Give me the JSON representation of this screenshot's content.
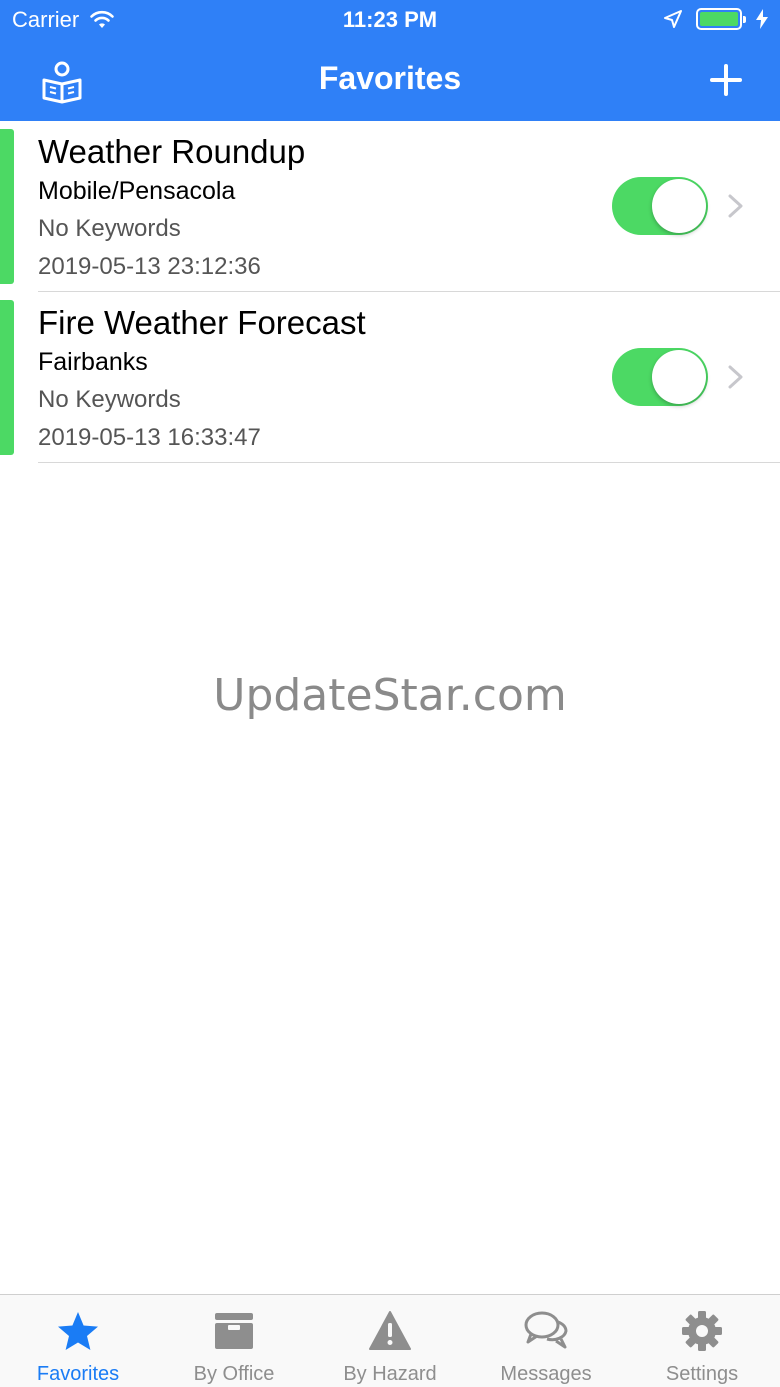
{
  "status_bar": {
    "carrier": "Carrier",
    "time": "11:23 PM",
    "battery_level": 1.0
  },
  "nav": {
    "title": "Favorites",
    "left_icon": "reader-book-icon",
    "right_icon": "plus-icon"
  },
  "favorites": [
    {
      "title": "Weather Roundup",
      "office": "Mobile/Pensacola",
      "keywords": "No Keywords",
      "timestamp": "2019-05-13 23:12:36",
      "enabled": true
    },
    {
      "title": "Fire Weather Forecast",
      "office": "Fairbanks",
      "keywords": "No Keywords",
      "timestamp": "2019-05-13 16:33:47",
      "enabled": true
    }
  ],
  "watermark": "UpdateStar.com",
  "tabs": [
    {
      "label": "Favorites",
      "icon": "star-icon",
      "active": true
    },
    {
      "label": "By Office",
      "icon": "cabinet-icon",
      "active": false
    },
    {
      "label": "By Hazard",
      "icon": "warning-icon",
      "active": false
    },
    {
      "label": "Messages",
      "icon": "chat-bubbles-icon",
      "active": false
    },
    {
      "label": "Settings",
      "icon": "gear-icon",
      "active": false
    }
  ],
  "colors": {
    "nav_blue": "#2f80f7",
    "accent_green": "#4cd964",
    "tab_active": "#1a7cf5",
    "tab_inactive": "#8e8e8e"
  }
}
